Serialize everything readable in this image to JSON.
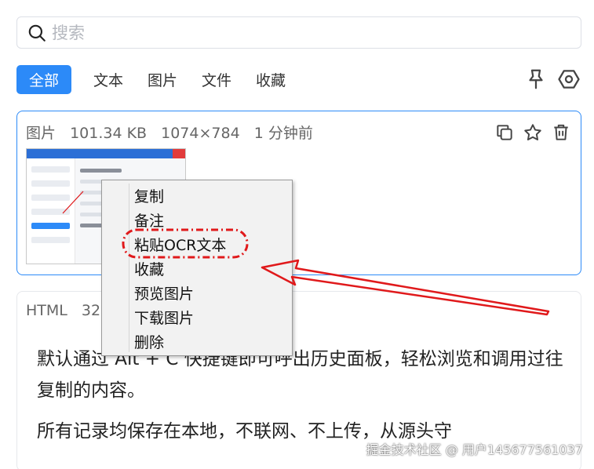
{
  "search": {
    "placeholder": "搜索"
  },
  "tabs": [
    {
      "label": "全部",
      "active": true
    },
    {
      "label": "文本",
      "active": false
    },
    {
      "label": "图片",
      "active": false
    },
    {
      "label": "文件",
      "active": false
    },
    {
      "label": "收藏",
      "active": false
    }
  ],
  "top_icons": [
    "pin-icon",
    "settings-icon"
  ],
  "card1": {
    "type": "图片",
    "size": "101.34 KB",
    "dimensions": "1074×784",
    "time": "1 分钟前",
    "actions": [
      "copy-icon",
      "star-icon",
      "trash-icon"
    ]
  },
  "card2": {
    "type": "HTML",
    "count": "32",
    "paragraph1": "默认通过 Alt + C 快捷键即可呼出历史面板，轻松浏览和调用过往复制的内容。",
    "paragraph2": "所有记录均保存在本地，不联网、不上传，从源头守"
  },
  "context_menu": {
    "items": [
      "复制",
      "备注",
      "粘贴OCR文本",
      "收藏",
      "预览图片",
      "下载图片",
      "删除"
    ],
    "highlighted": "粘贴OCR文本"
  },
  "colors": {
    "accent": "#2c8af8",
    "annotation": "#e0191b"
  },
  "watermark": "掘金技术社区 @ 用户145677561037"
}
